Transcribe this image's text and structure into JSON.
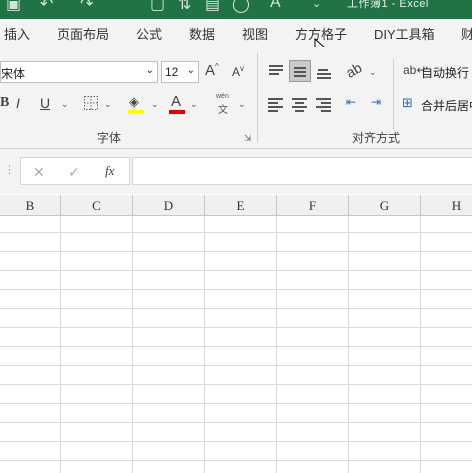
{
  "window": {
    "title": "工作簿1 - Excel"
  },
  "tabs": [
    "插入",
    "页面布局",
    "公式",
    "数据",
    "视图",
    "方方格子",
    "DIY工具箱",
    "财"
  ],
  "font": {
    "name": "宋体",
    "size": "12"
  },
  "buttons": {
    "increase_font": "A",
    "decrease_font": "A",
    "bold": "B",
    "underline": "U",
    "font_color": "A",
    "phonetic_top": "wén",
    "phonetic_bottom": "文",
    "wrap_text": "自动换行",
    "merge_center": "合并后居中"
  },
  "groups": {
    "font": "字体",
    "alignment": "对齐方式"
  },
  "formula_bar": {
    "cancel": "✕",
    "enter": "✓",
    "fx": "fx",
    "value": ""
  },
  "columns": [
    "B",
    "C",
    "D",
    "E",
    "F",
    "G",
    "H"
  ],
  "colors": {
    "excel_green": "#217346",
    "highlight": "#ffff00",
    "font_color": "#e00000"
  }
}
